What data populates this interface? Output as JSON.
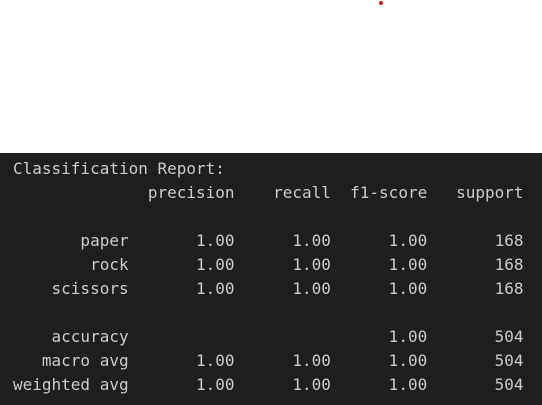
{
  "output": {
    "report_lines": [
      "Classification Report:",
      "              precision    recall  f1-score   support",
      "",
      "       paper       1.00      1.00      1.00       168",
      "        rock       1.00      1.00      1.00       168",
      "    scissors       1.00      1.00      1.00       168",
      "",
      "    accuracy                           1.00       504",
      "   macro avg       1.00      1.00      1.00       504",
      "weighted avg       1.00      1.00      1.00       504"
    ]
  }
}
